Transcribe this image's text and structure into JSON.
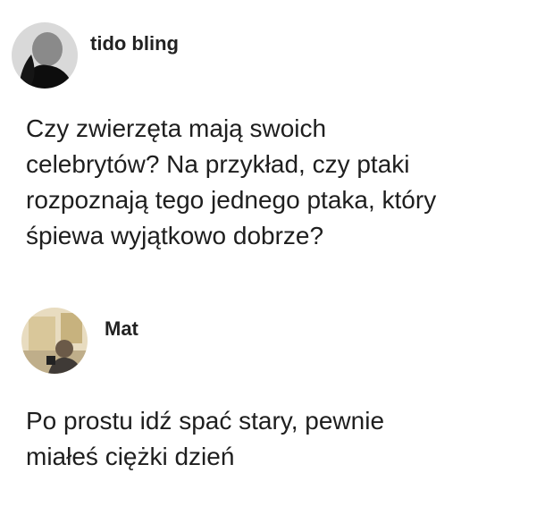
{
  "posts": [
    {
      "username": "tido bling",
      "text_lines": [
        "Czy zwierzęta mają swoich",
        "celebrytów? Na przykład, czy ptaki",
        "rozpoznają tego jednego ptaka, który",
        "śpiewa wyjątkowo dobrze?"
      ]
    },
    {
      "username": "Mat",
      "text_lines": [
        "Po prostu idź spać stary, pewnie",
        "miałeś ciężki dzień"
      ]
    }
  ]
}
